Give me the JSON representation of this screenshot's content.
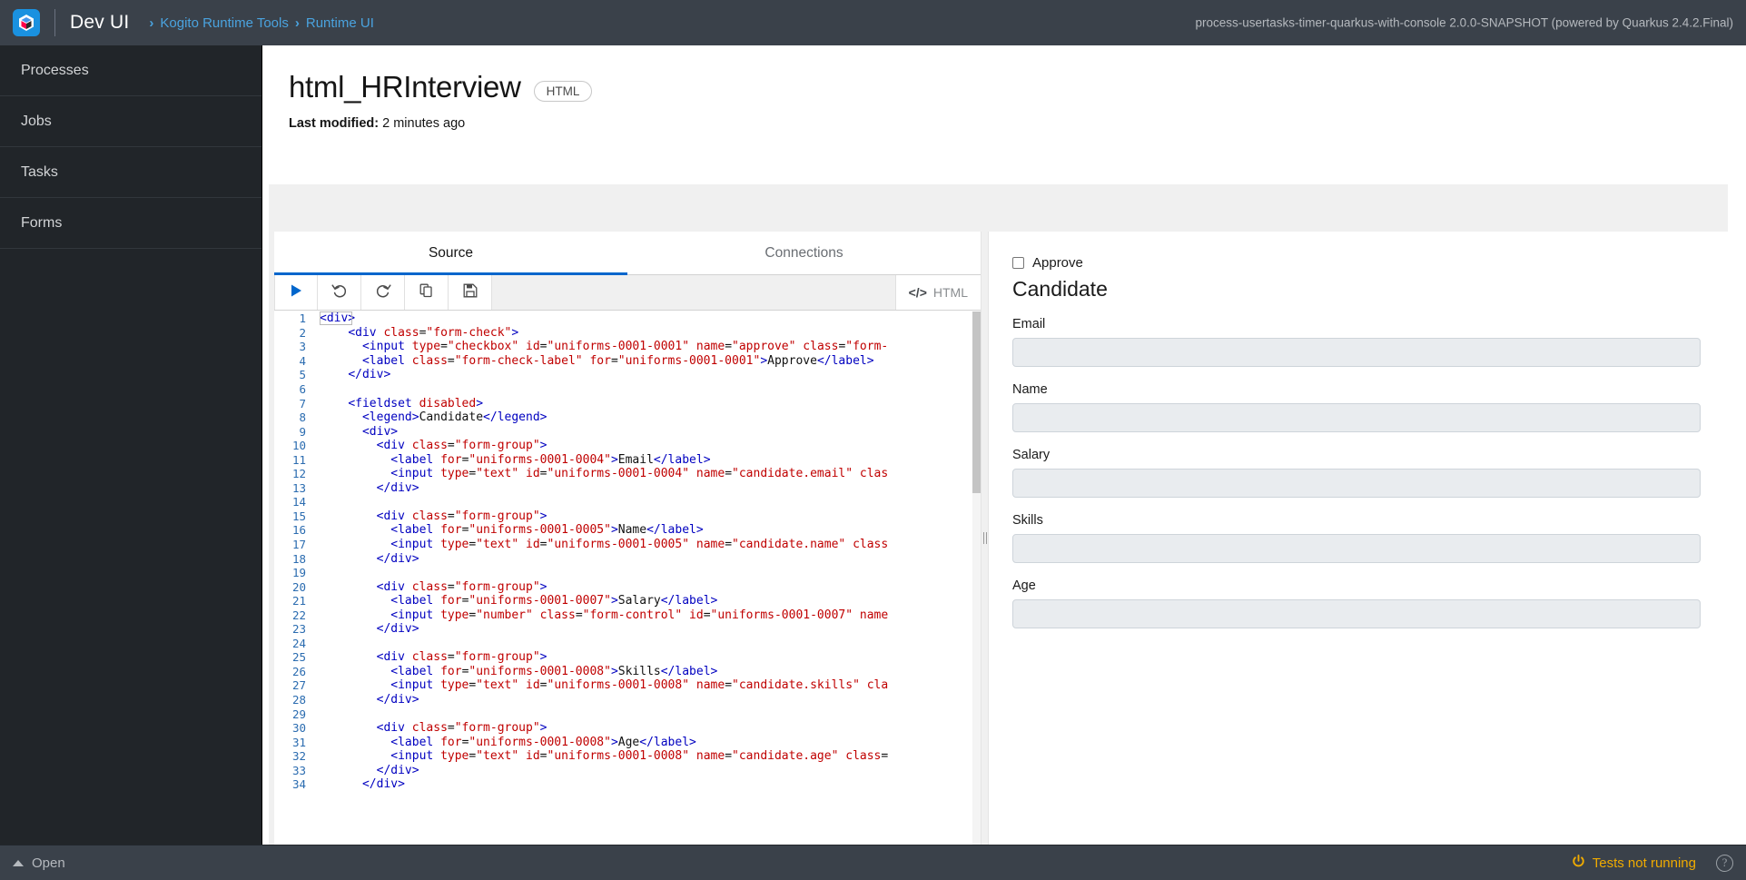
{
  "topbar": {
    "brand": "Dev UI",
    "logo_icon": "quarkus-logo-icon",
    "breadcrumb": [
      {
        "label": "Kogito Runtime Tools",
        "sep": "›"
      },
      {
        "label": "Runtime UI",
        "sep": "›"
      }
    ],
    "version": "process-usertasks-timer-quarkus-with-console 2.0.0-SNAPSHOT (powered by Quarkus 2.4.2.Final)"
  },
  "sidebar": {
    "items": [
      {
        "label": "Processes"
      },
      {
        "label": "Jobs"
      },
      {
        "label": "Tasks"
      },
      {
        "label": "Forms"
      }
    ]
  },
  "page": {
    "title": "html_HRInterview",
    "type_badge": "HTML",
    "last_modified_label": "Last modified:",
    "last_modified_value": "2 minutes ago"
  },
  "editor": {
    "tabs": [
      {
        "label": "Source",
        "active": true
      },
      {
        "label": "Connections",
        "active": false
      }
    ],
    "toolbar": [
      {
        "name": "run-button",
        "icon": "play-icon"
      },
      {
        "name": "undo-button",
        "icon": "undo-icon"
      },
      {
        "name": "redo-button",
        "icon": "redo-icon"
      },
      {
        "name": "copy-button",
        "icon": "copy-icon"
      },
      {
        "name": "save-button",
        "icon": "save-icon"
      }
    ],
    "language_badge": {
      "icon": "code-icon",
      "label": "HTML"
    },
    "code_lines": [
      {
        "n": 1,
        "html": "<span class=\"t-tag\">&lt;div&gt;</span>"
      },
      {
        "n": 2,
        "html": "    <span class=\"t-tag\">&lt;div</span> <span class=\"t-attr\">class</span>=<span class=\"t-str\">\"form-check\"</span><span class=\"t-tag\">&gt;</span>"
      },
      {
        "n": 3,
        "html": "      <span class=\"t-tag\">&lt;input</span> <span class=\"t-attr\">type</span>=<span class=\"t-str\">\"checkbox\"</span> <span class=\"t-attr\">id</span>=<span class=\"t-str\">\"uniforms-0001-0001\"</span> <span class=\"t-attr\">name</span>=<span class=\"t-str\">\"approve\"</span> <span class=\"t-attr\">class</span>=<span class=\"t-str\">\"form-</span>"
      },
      {
        "n": 4,
        "html": "      <span class=\"t-tag\">&lt;label</span> <span class=\"t-attr\">class</span>=<span class=\"t-str\">\"form-check-label\"</span> <span class=\"t-attr\">for</span>=<span class=\"t-str\">\"uniforms-0001-0001\"</span><span class=\"t-tag\">&gt;</span>Approve<span class=\"t-tag\">&lt;/label&gt;</span>"
      },
      {
        "n": 5,
        "html": "    <span class=\"t-tag\">&lt;/div&gt;</span>"
      },
      {
        "n": 6,
        "html": ""
      },
      {
        "n": 7,
        "html": "    <span class=\"t-tag\">&lt;fieldset</span> <span class=\"t-attr\">disabled</span><span class=\"t-tag\">&gt;</span>"
      },
      {
        "n": 8,
        "html": "      <span class=\"t-tag\">&lt;legend&gt;</span>Candidate<span class=\"t-tag\">&lt;/legend&gt;</span>"
      },
      {
        "n": 9,
        "html": "      <span class=\"t-tag\">&lt;div&gt;</span>"
      },
      {
        "n": 10,
        "html": "        <span class=\"t-tag\">&lt;div</span> <span class=\"t-attr\">class</span>=<span class=\"t-str\">\"form-group\"</span><span class=\"t-tag\">&gt;</span>"
      },
      {
        "n": 11,
        "html": "          <span class=\"t-tag\">&lt;label</span> <span class=\"t-attr\">for</span>=<span class=\"t-str\">\"uniforms-0001-0004\"</span><span class=\"t-tag\">&gt;</span>Email<span class=\"t-tag\">&lt;/label&gt;</span>"
      },
      {
        "n": 12,
        "html": "          <span class=\"t-tag\">&lt;input</span> <span class=\"t-attr\">type</span>=<span class=\"t-str\">\"text\"</span> <span class=\"t-attr\">id</span>=<span class=\"t-str\">\"uniforms-0001-0004\"</span> <span class=\"t-attr\">name</span>=<span class=\"t-str\">\"candidate.email\"</span> <span class=\"t-attr\">clas</span>"
      },
      {
        "n": 13,
        "html": "        <span class=\"t-tag\">&lt;/div&gt;</span>"
      },
      {
        "n": 14,
        "html": ""
      },
      {
        "n": 15,
        "html": "        <span class=\"t-tag\">&lt;div</span> <span class=\"t-attr\">class</span>=<span class=\"t-str\">\"form-group\"</span><span class=\"t-tag\">&gt;</span>"
      },
      {
        "n": 16,
        "html": "          <span class=\"t-tag\">&lt;label</span> <span class=\"t-attr\">for</span>=<span class=\"t-str\">\"uniforms-0001-0005\"</span><span class=\"t-tag\">&gt;</span>Name<span class=\"t-tag\">&lt;/label&gt;</span>"
      },
      {
        "n": 17,
        "html": "          <span class=\"t-tag\">&lt;input</span> <span class=\"t-attr\">type</span>=<span class=\"t-str\">\"text\"</span> <span class=\"t-attr\">id</span>=<span class=\"t-str\">\"uniforms-0001-0005\"</span> <span class=\"t-attr\">name</span>=<span class=\"t-str\">\"candidate.name\"</span> <span class=\"t-attr\">class</span>"
      },
      {
        "n": 18,
        "html": "        <span class=\"t-tag\">&lt;/div&gt;</span>"
      },
      {
        "n": 19,
        "html": ""
      },
      {
        "n": 20,
        "html": "        <span class=\"t-tag\">&lt;div</span> <span class=\"t-attr\">class</span>=<span class=\"t-str\">\"form-group\"</span><span class=\"t-tag\">&gt;</span>"
      },
      {
        "n": 21,
        "html": "          <span class=\"t-tag\">&lt;label</span> <span class=\"t-attr\">for</span>=<span class=\"t-str\">\"uniforms-0001-0007\"</span><span class=\"t-tag\">&gt;</span>Salary<span class=\"t-tag\">&lt;/label&gt;</span>"
      },
      {
        "n": 22,
        "html": "          <span class=\"t-tag\">&lt;input</span> <span class=\"t-attr\">type</span>=<span class=\"t-str\">\"number\"</span> <span class=\"t-attr\">class</span>=<span class=\"t-str\">\"form-control\"</span> <span class=\"t-attr\">id</span>=<span class=\"t-str\">\"uniforms-0001-0007\"</span> <span class=\"t-attr\">name</span>"
      },
      {
        "n": 23,
        "html": "        <span class=\"t-tag\">&lt;/div&gt;</span>"
      },
      {
        "n": 24,
        "html": ""
      },
      {
        "n": 25,
        "html": "        <span class=\"t-tag\">&lt;div</span> <span class=\"t-attr\">class</span>=<span class=\"t-str\">\"form-group\"</span><span class=\"t-tag\">&gt;</span>"
      },
      {
        "n": 26,
        "html": "          <span class=\"t-tag\">&lt;label</span> <span class=\"t-attr\">for</span>=<span class=\"t-str\">\"uniforms-0001-0008\"</span><span class=\"t-tag\">&gt;</span>Skills<span class=\"t-tag\">&lt;/label&gt;</span>"
      },
      {
        "n": 27,
        "html": "          <span class=\"t-tag\">&lt;input</span> <span class=\"t-attr\">type</span>=<span class=\"t-str\">\"text\"</span> <span class=\"t-attr\">id</span>=<span class=\"t-str\">\"uniforms-0001-0008\"</span> <span class=\"t-attr\">name</span>=<span class=\"t-str\">\"candidate.skills\"</span> <span class=\"t-attr\">cla</span>"
      },
      {
        "n": 28,
        "html": "        <span class=\"t-tag\">&lt;/div&gt;</span>"
      },
      {
        "n": 29,
        "html": ""
      },
      {
        "n": 30,
        "html": "        <span class=\"t-tag\">&lt;div</span> <span class=\"t-attr\">class</span>=<span class=\"t-str\">\"form-group\"</span><span class=\"t-tag\">&gt;</span>"
      },
      {
        "n": 31,
        "html": "          <span class=\"t-tag\">&lt;label</span> <span class=\"t-attr\">for</span>=<span class=\"t-str\">\"uniforms-0001-0008\"</span><span class=\"t-tag\">&gt;</span>Age<span class=\"t-tag\">&lt;/label&gt;</span>"
      },
      {
        "n": 32,
        "html": "          <span class=\"t-tag\">&lt;input</span> <span class=\"t-attr\">type</span>=<span class=\"t-str\">\"text\"</span> <span class=\"t-attr\">id</span>=<span class=\"t-str\">\"uniforms-0001-0008\"</span> <span class=\"t-attr\">name</span>=<span class=\"t-str\">\"candidate.age\"</span> <span class=\"t-attr\">class</span>="
      },
      {
        "n": 33,
        "html": "        <span class=\"t-tag\">&lt;/div&gt;</span>"
      },
      {
        "n": 34,
        "html": "      <span class=\"t-tag\">&lt;/div&gt;</span>"
      }
    ]
  },
  "preview": {
    "approve_label": "Approve",
    "approve_checked": false,
    "legend": "Candidate",
    "fields": [
      {
        "label": "Email",
        "value": "",
        "placeholder": ""
      },
      {
        "label": "Name",
        "value": "",
        "placeholder": ""
      },
      {
        "label": "Salary",
        "value": "",
        "placeholder": ""
      },
      {
        "label": "Skills",
        "value": "",
        "placeholder": ""
      },
      {
        "label": "Age",
        "value": "",
        "placeholder": ""
      }
    ]
  },
  "bottombar": {
    "open_label": "Open",
    "tests_status": "Tests not running",
    "help_label": "?"
  },
  "colors": {
    "accent_blue": "#0066cc",
    "link_blue": "#4aa3df",
    "dark_chrome": "#3a414a",
    "sidebar_bg": "#212529",
    "warning_amber": "#f0ab00"
  }
}
